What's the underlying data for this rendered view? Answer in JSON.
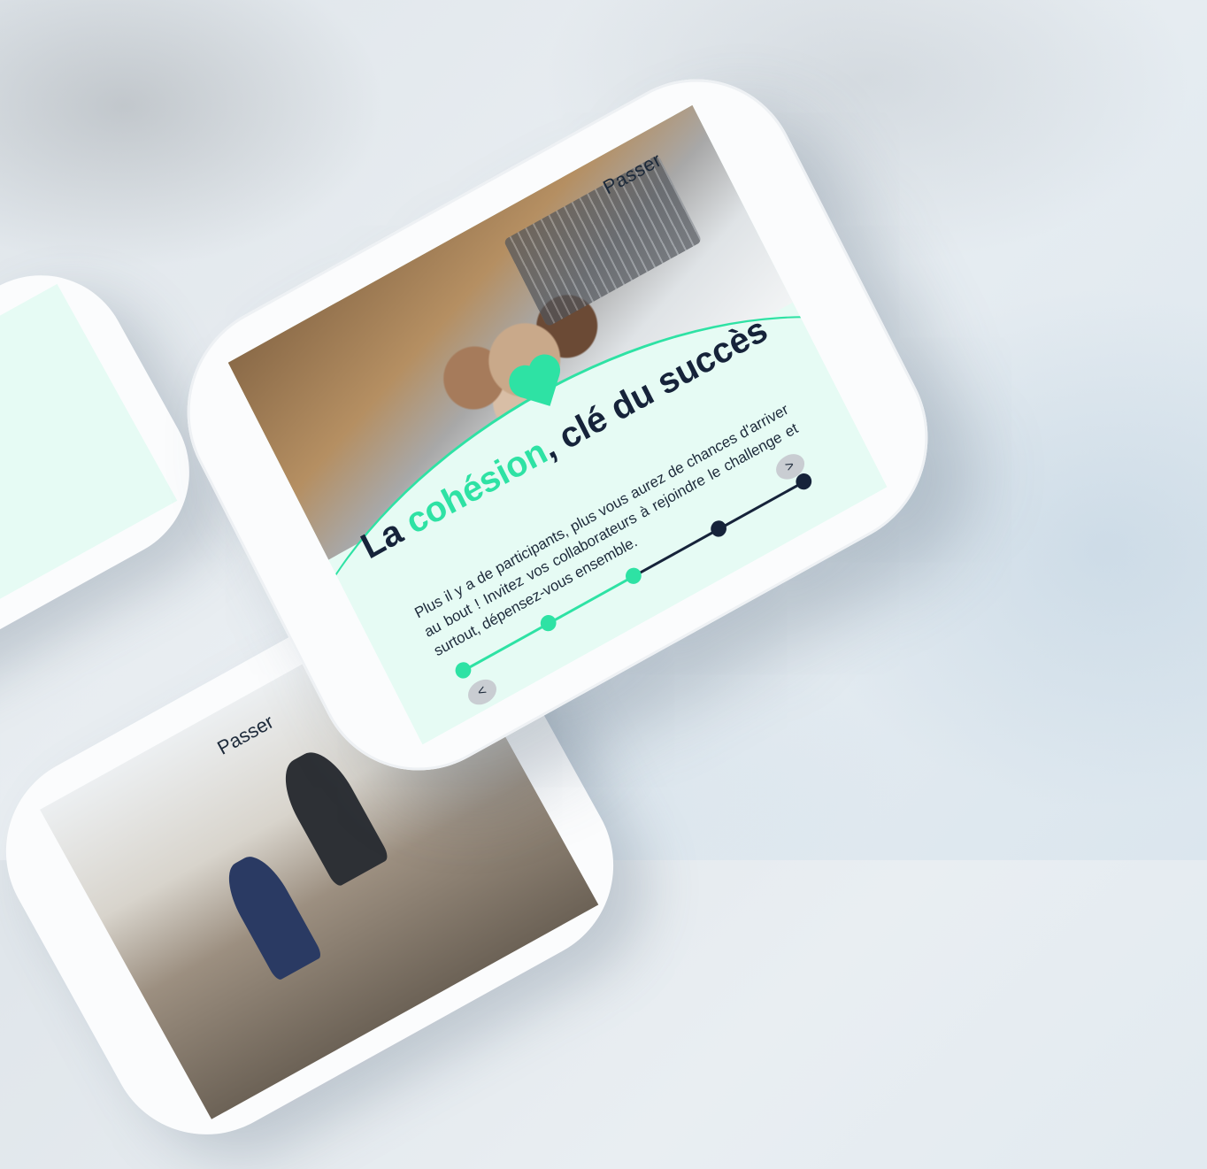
{
  "main_screen": {
    "skip_label": "Passer",
    "title_prefix": "La ",
    "title_accent": "cohésion",
    "title_suffix": ", clé du succès",
    "description": "Plus il y a de participants, plus vous aurez de chances d'arriver au bout ! Invitez vos collaborateurs à rejoindre le challenge et surtout, dépensez-vous ensemble.",
    "prev_icon": "chevron-left-icon",
    "next_icon": "chevron-right-icon",
    "prev_glyph": "<",
    "next_glyph": ">",
    "steps_total": 5,
    "steps_completed": 3
  },
  "bottom_screen": {
    "skip_label": "Passer"
  },
  "colors": {
    "accent": "#2ee2a4",
    "dark": "#16233a",
    "screen_bg": "#e6fbf4"
  }
}
